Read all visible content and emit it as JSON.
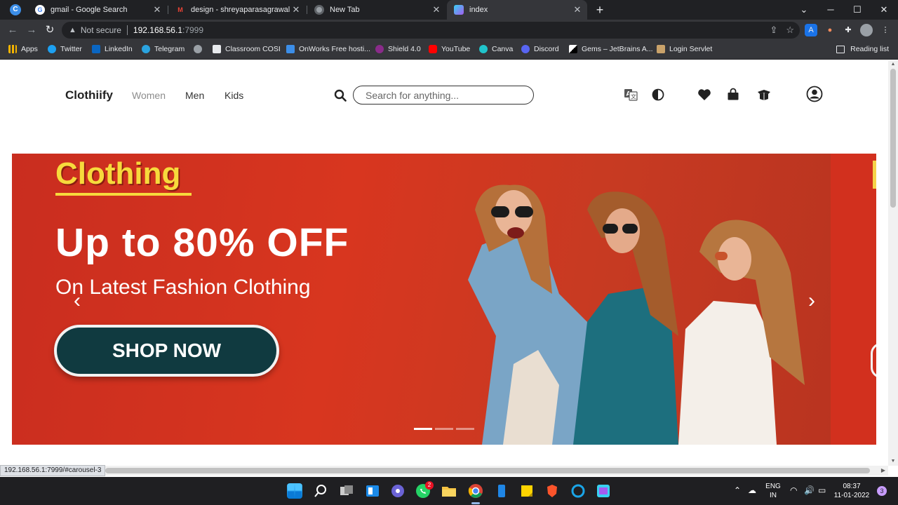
{
  "browser": {
    "tabs": [
      {
        "title": "gmail - Google Search",
        "favicon": "google-icon"
      },
      {
        "title": "design - shreyaparasagrawal@gmail.com",
        "favicon": "gmail-icon"
      },
      {
        "title": "New Tab",
        "favicon": "chrome-icon"
      },
      {
        "title": "index",
        "favicon": "page-icon",
        "active": true
      }
    ],
    "url": {
      "security": "Not secure",
      "host": "192.168.56.1",
      "port": ":7999"
    },
    "bookmarks": [
      {
        "label": "Apps",
        "color": "#f4b400"
      },
      {
        "label": "Twitter",
        "color": "#1da1f2"
      },
      {
        "label": "LinkedIn",
        "color": "#0a66c2"
      },
      {
        "label": "Telegram",
        "color": "#2aa3df"
      },
      {
        "label": "",
        "color": "#9aa0a6"
      },
      {
        "label": "Classroom COSI",
        "color": "#e8eaed"
      },
      {
        "label": "OnWorks Free hosti...",
        "color": "#3c8ee8"
      },
      {
        "label": "Shield 4.0",
        "color": "#8a2b8a"
      },
      {
        "label": "YouTube",
        "color": "#ff0000"
      },
      {
        "label": "Canva",
        "color": "#20c4cb"
      },
      {
        "label": "Discord",
        "color": "#5865f2"
      },
      {
        "label": "Gems – JetBrains A...",
        "color": "#ffffff"
      },
      {
        "label": "Login Servlet",
        "color": "#c9a26a"
      }
    ],
    "reading_list": "Reading list",
    "status_url": "192.168.56.1:7999/#carousel-3"
  },
  "site": {
    "brand": "Clothiify",
    "nav_links": [
      "Women",
      "Men",
      "Kids"
    ],
    "search_placeholder": "Search for anything...",
    "icons": [
      "translate-icon",
      "contrast-icon",
      "heart-icon",
      "shopping-bag-icon",
      "box-icon",
      "user-icon"
    ]
  },
  "hero": {
    "eyebrow": "Clothing",
    "headline": "Up to 80% OFF",
    "subline": "On Latest Fashion Clothing",
    "cta": "SHOP NOW",
    "prev": "‹",
    "next": "›",
    "slide_count": 3,
    "active_slide": 1
  },
  "taskbar": {
    "whatsapp_badge": "2",
    "lang_top": "ENG",
    "lang_bottom": "IN",
    "time": "08:37",
    "date": "11-01-2022",
    "notifications": "3"
  },
  "colors": {
    "accent": "#103a40",
    "banner": "#d2301e",
    "eyebrow": "#f7da3c"
  }
}
